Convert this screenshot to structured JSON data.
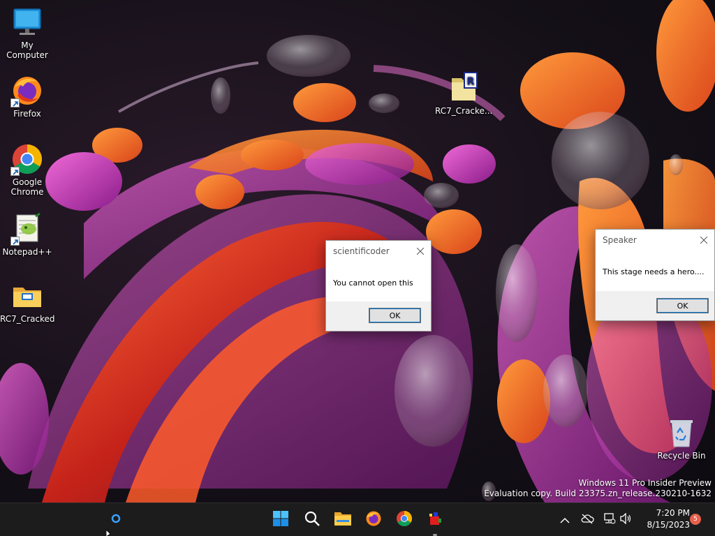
{
  "desktop": {
    "icons": [
      {
        "label": "My Computer",
        "icon": "monitor-icon"
      },
      {
        "label": "Firefox",
        "icon": "firefox-icon"
      },
      {
        "label": "Google Chrome",
        "icon": "chrome-icon"
      },
      {
        "label": "Notepad++",
        "icon": "notepadpp-icon"
      },
      {
        "label": "RC7_Cracked",
        "icon": "folder-icon"
      },
      {
        "label": "RC7_Cracke...",
        "icon": "winrar-archive-icon"
      },
      {
        "label": "Recycle Bin",
        "icon": "recycle-bin-icon"
      }
    ]
  },
  "dialogs": {
    "scientificoder": {
      "title": "scientificoder",
      "message": "You cannot open this",
      "ok_label": "OK"
    },
    "speaker": {
      "title": "Speaker",
      "message": "This stage needs a hero....",
      "ok_label": "OK"
    }
  },
  "watermark": {
    "line1": "Windows 11 Pro Insider Preview",
    "line2": "Evaluation copy. Build 23375.zn_release.230210-1632"
  },
  "taskbar": {
    "apps": [
      "start-icon",
      "search-icon",
      "file-explorer-icon",
      "firefox-icon",
      "chrome-icon",
      "roblox-app-icon"
    ],
    "tray_icons": [
      "chevron-up-icon",
      "cloud-offline-icon",
      "network-icon",
      "volume-icon"
    ],
    "time": "7:20 PM",
    "date": "8/15/2023",
    "notification_count": "5"
  },
  "colors": {
    "taskbar_bg": "#1c1c1c",
    "accent": "#0078d7",
    "dialog_footer": "#f0f0f0"
  }
}
